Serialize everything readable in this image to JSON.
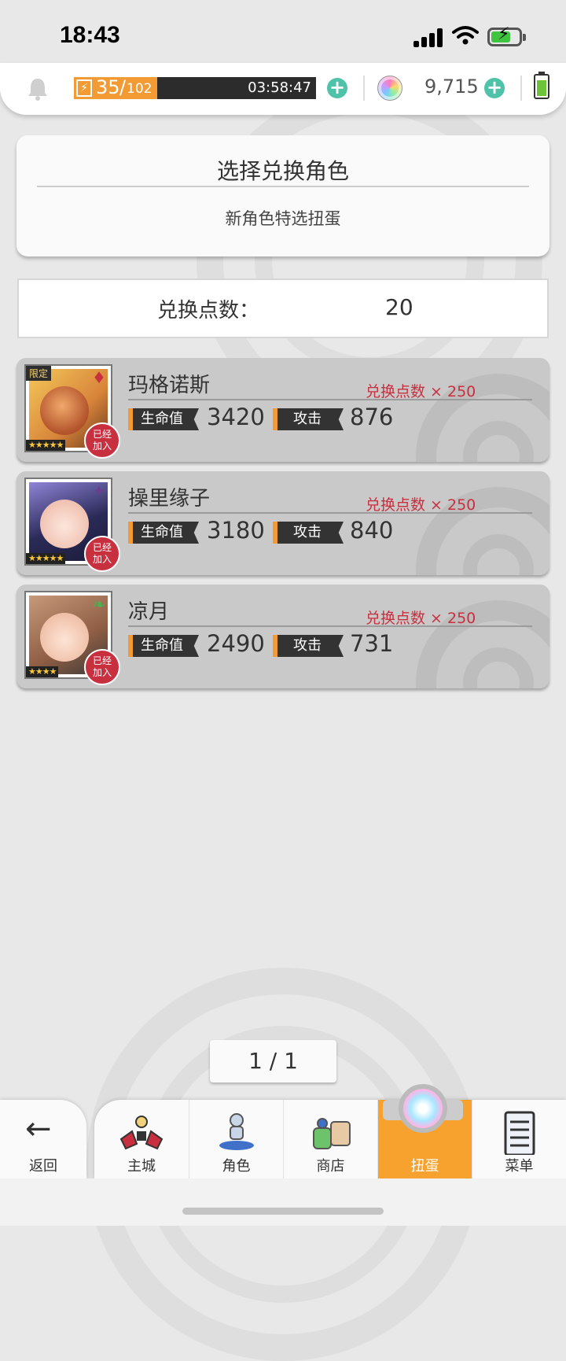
{
  "status_bar": {
    "time": "18:43"
  },
  "resources": {
    "stamina_current": "35",
    "stamina_separator": "/",
    "stamina_max": "102",
    "stamina_fraction": 0.343,
    "stamina_timer": "03:58:47",
    "gem_count": "9,715"
  },
  "header": {
    "title": "选择兑换角色",
    "subtitle": "新角色特选扭蛋"
  },
  "points": {
    "label": "兑换点数：",
    "value": "20"
  },
  "characters": [
    {
      "name": "玛格诺斯",
      "cost": "兑换点数 × 250",
      "hp_label": "生命值",
      "hp": "3420",
      "atk_label": "攻击",
      "atk": "876",
      "stars": "★★★★★",
      "limited": "限定",
      "joined": "已经加入",
      "attribute_icon": "red-diamond-icon"
    },
    {
      "name": "操里缘子",
      "cost": "兑换点数 × 250",
      "hp_label": "生命值",
      "hp": "3180",
      "atk_label": "攻击",
      "atk": "840",
      "stars": "★★★★★",
      "joined": "已经加入",
      "attribute_icon": "purple-star-icon"
    },
    {
      "name": "凉月",
      "cost": "兑换点数 × 250",
      "hp_label": "生命值",
      "hp": "2490",
      "atk_label": "攻击",
      "atk": "731",
      "stars": "★★★★",
      "joined": "已经加入",
      "attribute_icon": "green-leaf-icon"
    }
  ],
  "pagination": {
    "text": "1 / 1"
  },
  "nav": {
    "back_label": "返回",
    "items": [
      {
        "label": "主城",
        "icon": "castle-icon"
      },
      {
        "label": "角色",
        "icon": "character-icon"
      },
      {
        "label": "商店",
        "icon": "shop-icon"
      },
      {
        "label": "扭蛋",
        "icon": "gacha-icon",
        "active": true
      },
      {
        "label": "菜单",
        "icon": "menu-list-icon"
      }
    ]
  },
  "colors": {
    "accent": "#f7a22e",
    "cost_red": "#c8303f",
    "plus_teal": "#4fc3a9"
  }
}
